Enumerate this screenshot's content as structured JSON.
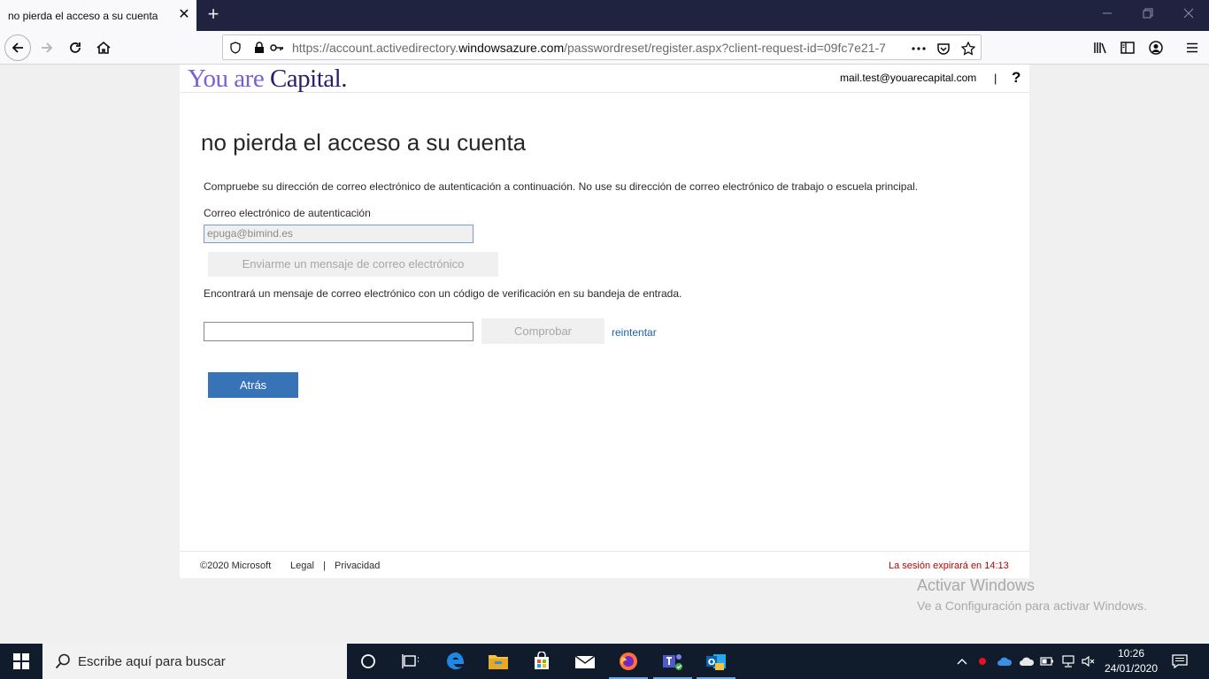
{
  "browser": {
    "tab_title": "no pierda el acceso a su cuenta",
    "url_prefix": "https://account.activedirectory.",
    "url_domain": "windowsazure.com",
    "url_suffix": "/passwordreset/register.aspx?client-request-id=09fc7e21-7"
  },
  "header": {
    "logo_part1": "You are ",
    "logo_part2": "Capital.",
    "email": "mail.test@youarecapital.com",
    "separator": "|",
    "help": "?"
  },
  "main": {
    "title": "no pierda el acceso a su cuenta",
    "description": "Compruebe su dirección de correo electrónico de autenticación a continuación. No use su dirección de correo electrónico de trabajo o escuela principal.",
    "email_label": "Correo electrónico de autenticación",
    "email_value": "epuga@bimind.es",
    "send_button": "Enviarme un mensaje de correo electrónico",
    "info": "Encontrará un mensaje de correo electrónico con un código de verificación en su bandeja de entrada.",
    "code_value": "",
    "verify_button": "Comprobar",
    "retry_link": "reintentar",
    "back_button": "Atrás"
  },
  "footer": {
    "copyright": "©2020 Microsoft",
    "legal": "Legal",
    "sep": "|",
    "privacy": "Privacidad",
    "session": "La sesión expirará en 14:13"
  },
  "watermark": {
    "title": "Activar Windows",
    "subtitle": "Ve a Configuración para activar Windows."
  },
  "taskbar": {
    "search_placeholder": "Escribe aquí para buscar",
    "time": "10:26",
    "date": "24/01/2020"
  },
  "colors": {
    "primary_button": "#3873b8",
    "link": "#1f5fa8",
    "session_warning": "#c00000",
    "logo_light": "#7a5fd6",
    "logo_dark": "#2a1f6b",
    "tabbar": "#202340",
    "taskbar": "#101c2c"
  }
}
